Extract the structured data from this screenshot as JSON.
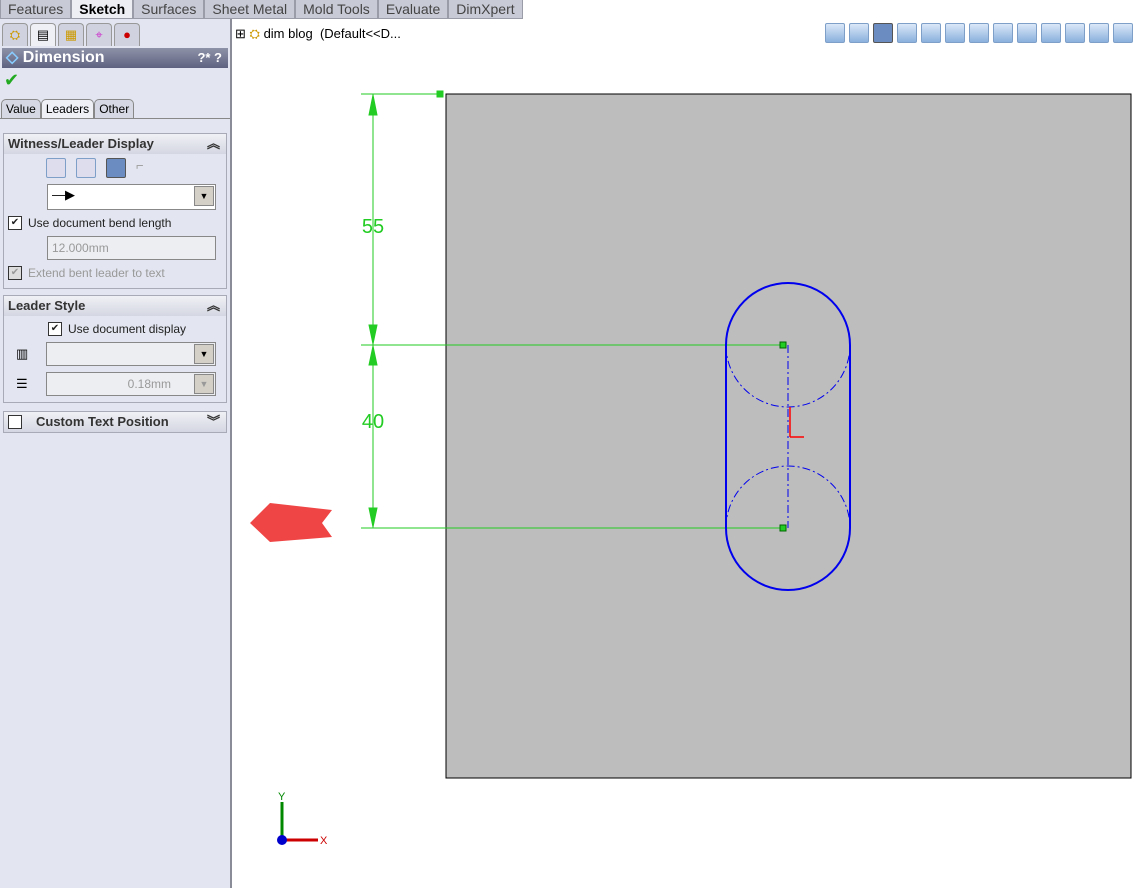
{
  "tabs": [
    "Features",
    "Sketch",
    "Surfaces",
    "Sheet Metal",
    "Mold Tools",
    "Evaluate",
    "DimXpert"
  ],
  "active_tab": "Sketch",
  "tree": {
    "label": "dim blog",
    "config": "(Default<<D..."
  },
  "panel": {
    "title": "Dimension",
    "help": "?* ?",
    "subtabs": [
      "Value",
      "Leaders",
      "Other"
    ],
    "witness": {
      "title": "Witness/Leader Display",
      "use_bend": "Use document bend length",
      "bend_value": "12.000mm",
      "extend": "Extend bent leader to text"
    },
    "leader_style": {
      "title": "Leader Style",
      "use_display": "Use document display",
      "thickness": "0.18mm"
    },
    "custom_text": {
      "title": "Custom Text Position"
    }
  },
  "dims": {
    "upper": "55",
    "lower": "40"
  },
  "triad": {
    "x": "X",
    "y": "Y"
  },
  "toolbar_icons": [
    "normal-to",
    "isometric",
    "shaded-with-edges",
    "shaded",
    "hidden-lines-removed",
    "hidden-lines-visible",
    "wireframe",
    "shadows",
    "zoom-to-fit",
    "zoom-to-area",
    "previous-view",
    "section-view",
    "view-orientation"
  ],
  "colors": {
    "sketch": "#0000ff",
    "dimension": "#00cc00",
    "part": "#bdbdbd",
    "arrow": "#ff4040"
  }
}
